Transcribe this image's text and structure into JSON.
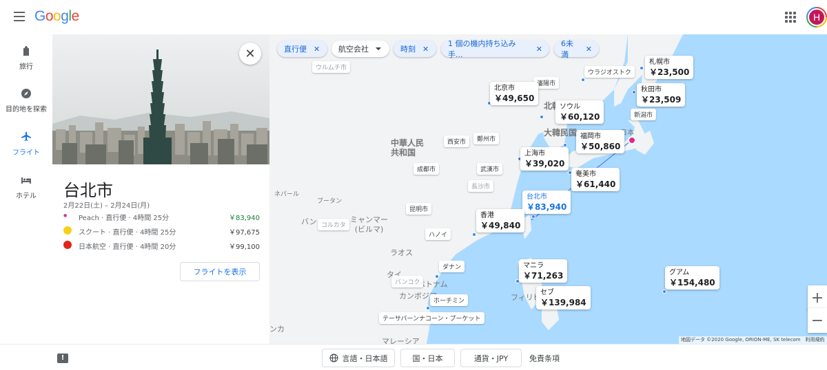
{
  "header": {
    "logo_text": "Google",
    "avatar_letter": "H"
  },
  "nav": [
    {
      "label": "旅行",
      "icon": "suitcase-icon"
    },
    {
      "label": "目的地を探索",
      "icon": "compass-icon"
    },
    {
      "label": "フライト",
      "icon": "airplane-icon",
      "active": true
    },
    {
      "label": "ホテル",
      "icon": "bed-icon"
    }
  ],
  "panel": {
    "city": "台北市",
    "dates": "2月22日(土) – 2月24日(月)",
    "flights": [
      {
        "airline": "Peach",
        "detail": "Peach · 直行便 · 4時間 25分",
        "price": "￥83,940",
        "color": "#d6338a",
        "best": true
      },
      {
        "airline": "スクート",
        "detail": "スクート · 直行便 · 4時間 25分",
        "price": "￥97,675",
        "color": "#f7d117",
        "best": false
      },
      {
        "airline": "日本航空",
        "detail": "日本航空 · 直行便 · 4時間 20分",
        "price": "￥99,100",
        "color": "#e2231a",
        "best": false
      }
    ],
    "show_button": "フライトを表示"
  },
  "filters": [
    {
      "label": "直行便",
      "selected": true
    },
    {
      "label": "航空会社",
      "selected": false
    },
    {
      "label": "時刻",
      "selected": true
    },
    {
      "label": "1 個の機内持ち込み手...",
      "selected": true
    },
    {
      "label": "6未満",
      "selected": true
    }
  ],
  "price_labels": {
    "sapporo": {
      "city": "札幌市",
      "price": "￥23,500"
    },
    "akita": {
      "city": "秋田市",
      "price": "￥23,509"
    },
    "beijing": {
      "city": "北京市",
      "price": "￥49,650"
    },
    "seoul": {
      "city": "ソウル",
      "price": "￥60,120"
    },
    "fukuoka": {
      "city": "福岡市",
      "price": "￥50,860"
    },
    "shanghai": {
      "city": "上海市",
      "price": "￥39,020"
    },
    "amami": {
      "city": "奄美市",
      "price": "￥61,440"
    },
    "taipei": {
      "city": "台北市",
      "price": "￥83,940"
    },
    "hongkong": {
      "city": "香港",
      "price": "￥49,840"
    },
    "manila": {
      "city": "マニラ",
      "price": "￥71,263"
    },
    "cebu": {
      "city": "セブ",
      "price": "￥139,984"
    },
    "guam": {
      "city": "グアム",
      "price": "￥154,480"
    }
  },
  "city_labels": {
    "urumqi": "ウルムチ市",
    "vladivostok": "ウラジオストク",
    "shenyang": "瀋陽市",
    "niigata": "新潟市",
    "xian": "西安市",
    "zhengzhou": "鄭州市",
    "chengdu": "成都市",
    "wuhan": "武漢市",
    "changsha": "長沙市",
    "kunming": "昆明市",
    "kolkata": "コルカタ",
    "hanoi": "ハノイ",
    "danang": "ダナン",
    "bangkok": "バンコク",
    "hochiminh": "ホーチミン",
    "phuket": "テーサバーンナコーン・プーケット"
  },
  "map_text": {
    "china": "中華人民\n共和国",
    "korea": "大韓民国",
    "japan": "日本",
    "north": "北朝",
    "myanmar": "ミャンマー\n(ビルマ)",
    "nepal": "ネパール",
    "bhutan": "ブータン",
    "laos": "ラオス",
    "thai": "タイ",
    "vietnam": "ベトナム",
    "cambodia": "カンボジア",
    "philippines": "フィリピ",
    "bangla": "バン",
    "malaysia": "マレーシア",
    "lanka": "ンカ"
  },
  "map_attribution": "地図データ ©2020 Google, ORION-ME, SK telecom　利用規約",
  "footer": {
    "language": "言語・日本語",
    "country": "国・日本",
    "currency": "通貨・JPY",
    "terms": "免責条項"
  }
}
